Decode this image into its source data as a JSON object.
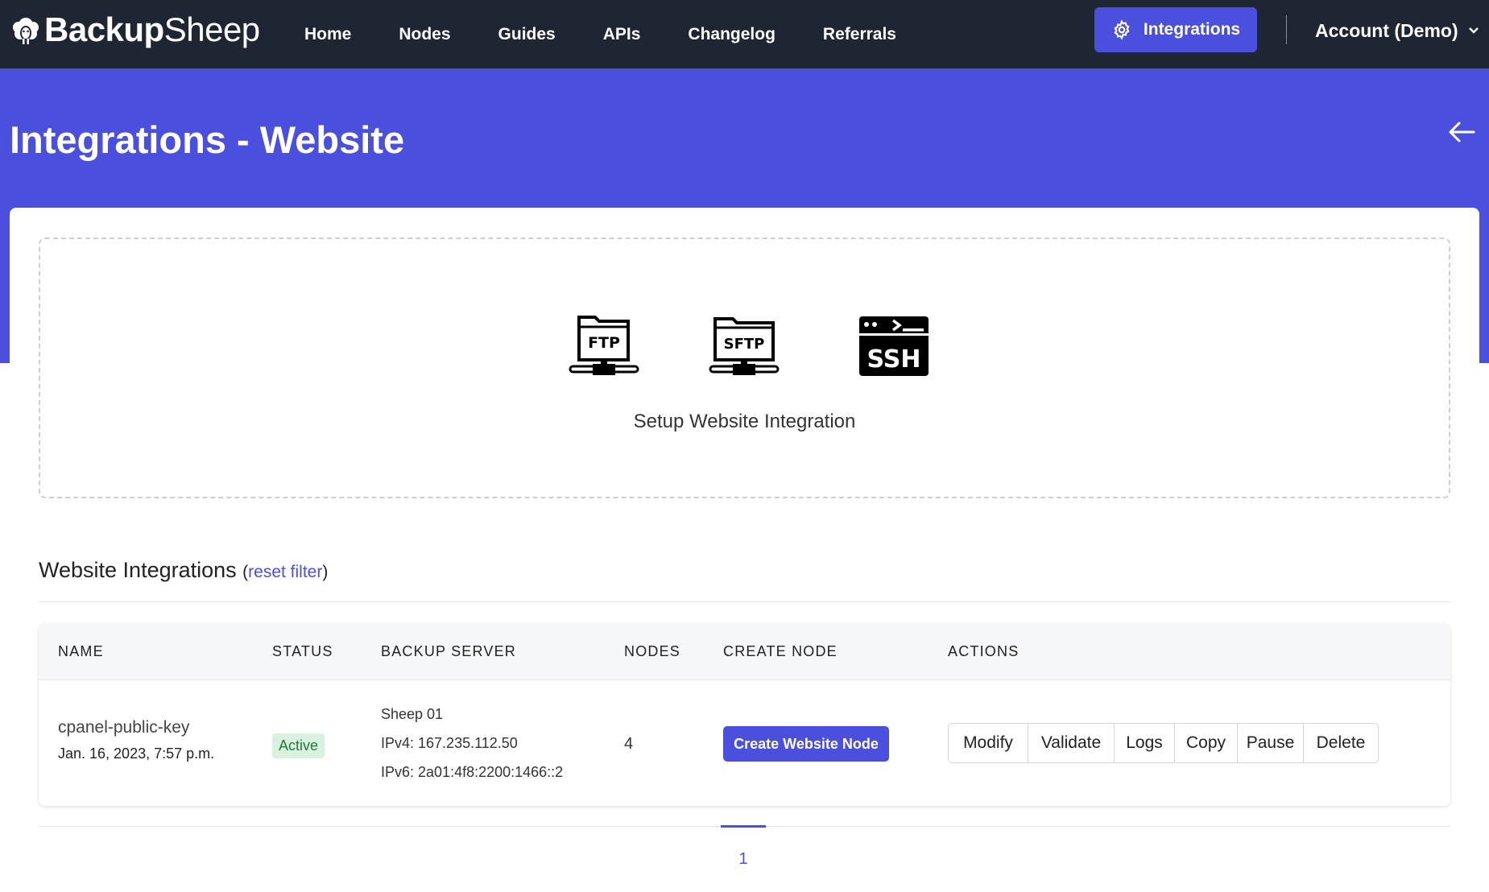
{
  "brand": {
    "bold": "Backup",
    "light": "Sheep"
  },
  "nav": {
    "links": [
      "Home",
      "Nodes",
      "Guides",
      "APIs",
      "Changelog",
      "Referrals"
    ],
    "integrations_button": "Integrations",
    "account": "Account (Demo)"
  },
  "page": {
    "title": "Integrations - Website"
  },
  "setup": {
    "protocols": [
      "FTP",
      "SFTP",
      "SSH"
    ],
    "label": "Setup Website Integration"
  },
  "section": {
    "title": "Website Integrations",
    "paren_open": "(",
    "reset_filter": "reset filter",
    "paren_close": ")"
  },
  "table": {
    "headers": [
      "NAME",
      "STATUS",
      "BACKUP SERVER",
      "NODES",
      "CREATE NODE",
      "ACTIONS"
    ],
    "rows": [
      {
        "name": "cpanel-public-key",
        "created": "Jan. 16, 2023, 7:57 p.m.",
        "status": "Active",
        "server_name": "Sheep 01",
        "ipv4": "IPv4: 167.235.112.50",
        "ipv6": "IPv6: 2a01:4f8:2200:1466::2",
        "nodes": "4",
        "create_node_label": "Create Website Node",
        "actions": [
          "Modify",
          "Validate",
          "Logs",
          "Copy",
          "Pause",
          "Delete"
        ]
      }
    ]
  },
  "pagination": {
    "current": "1"
  },
  "colors": {
    "navbar": "#1f2633",
    "accent": "#4a50dd",
    "status_bg": "#d9f2df",
    "status_text": "#1e7a36"
  }
}
